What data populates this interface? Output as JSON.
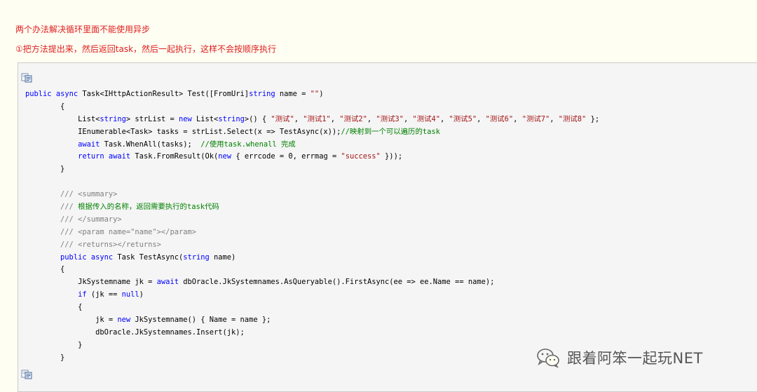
{
  "article": {
    "heading1": "两个办法解决循环里面不能使用异步",
    "heading2": "①把方法提出来，然后返回task，然后一起执行，这样不会按顺序执行"
  },
  "code": {
    "copy_icon": "copy-icon",
    "lines": [
      [
        {
          "t": "public",
          "c": "kw"
        },
        {
          "t": " "
        },
        {
          "t": "async",
          "c": "kw"
        },
        {
          "t": " Task<IHttpActionResult> Test([FromUri]"
        },
        {
          "t": "string",
          "c": "kw"
        },
        {
          "t": " name = "
        },
        {
          "t": "\"\"",
          "c": "str"
        },
        {
          "t": ")"
        }
      ],
      [
        {
          "t": "        {"
        }
      ],
      [
        {
          "t": "            List<"
        },
        {
          "t": "string",
          "c": "kw"
        },
        {
          "t": "> strList = "
        },
        {
          "t": "new",
          "c": "kw"
        },
        {
          "t": " List<"
        },
        {
          "t": "string",
          "c": "kw"
        },
        {
          "t": ">() { "
        },
        {
          "t": "\"测试\"",
          "c": "str"
        },
        {
          "t": ", "
        },
        {
          "t": "\"测试1\"",
          "c": "str"
        },
        {
          "t": ", "
        },
        {
          "t": "\"测试2\"",
          "c": "str"
        },
        {
          "t": ", "
        },
        {
          "t": "\"测试3\"",
          "c": "str"
        },
        {
          "t": ", "
        },
        {
          "t": "\"测试4\"",
          "c": "str"
        },
        {
          "t": ", "
        },
        {
          "t": "\"测试5\"",
          "c": "str"
        },
        {
          "t": ", "
        },
        {
          "t": "\"测试6\"",
          "c": "str"
        },
        {
          "t": ", "
        },
        {
          "t": "\"测试7\"",
          "c": "str"
        },
        {
          "t": ", "
        },
        {
          "t": "\"测试8\"",
          "c": "str"
        },
        {
          "t": " };"
        }
      ],
      [
        {
          "t": "            IEnumerable<Task> tasks = strList.Select(x => TestAsync(x));"
        },
        {
          "t": "//映射到一个可以遍历的task",
          "c": "cm"
        }
      ],
      [
        {
          "t": "            "
        },
        {
          "t": "await",
          "c": "kw"
        },
        {
          "t": " Task.WhenAll(tasks);  "
        },
        {
          "t": "//使用task.whenall 完成",
          "c": "cm"
        }
      ],
      [
        {
          "t": "            "
        },
        {
          "t": "return",
          "c": "kw"
        },
        {
          "t": " "
        },
        {
          "t": "await",
          "c": "kw"
        },
        {
          "t": " Task.FromResult(Ok("
        },
        {
          "t": "new",
          "c": "kw"
        },
        {
          "t": " { errcode = 0, errmag = "
        },
        {
          "t": "\"success\"",
          "c": "str"
        },
        {
          "t": " }));"
        }
      ],
      [
        {
          "t": "        }"
        }
      ],
      [
        {
          "t": ""
        }
      ],
      [
        {
          "t": "        "
        },
        {
          "t": "/// <summary>",
          "c": "xml"
        }
      ],
      [
        {
          "t": "        "
        },
        {
          "t": "///",
          "c": "xml"
        },
        {
          "t": " 根据传入的名称，返回需要执行的task代码",
          "c": "cm"
        }
      ],
      [
        {
          "t": "        "
        },
        {
          "t": "/// </summary>",
          "c": "xml"
        }
      ],
      [
        {
          "t": "        "
        },
        {
          "t": "/// <param name=\"name\"></param>",
          "c": "xml"
        }
      ],
      [
        {
          "t": "        "
        },
        {
          "t": "/// <returns></returns>",
          "c": "xml"
        }
      ],
      [
        {
          "t": "        "
        },
        {
          "t": "public",
          "c": "kw"
        },
        {
          "t": " "
        },
        {
          "t": "async",
          "c": "kw"
        },
        {
          "t": " Task TestAsync("
        },
        {
          "t": "string",
          "c": "kw"
        },
        {
          "t": " name)"
        }
      ],
      [
        {
          "t": "        {"
        }
      ],
      [
        {
          "t": "            JkSystemname jk = "
        },
        {
          "t": "await",
          "c": "kw"
        },
        {
          "t": " dbOracle.JkSystemnames.AsQueryable().FirstAsync(ee => ee.Name == name);"
        }
      ],
      [
        {
          "t": "            "
        },
        {
          "t": "if",
          "c": "kw"
        },
        {
          "t": " (jk == "
        },
        {
          "t": "null",
          "c": "kw"
        },
        {
          "t": ")"
        }
      ],
      [
        {
          "t": "            {"
        }
      ],
      [
        {
          "t": "                jk = "
        },
        {
          "t": "new",
          "c": "kw"
        },
        {
          "t": " JkSystemname() { Name = name };"
        }
      ],
      [
        {
          "t": "                dbOracle.JkSystemnames.Insert(jk);"
        }
      ],
      [
        {
          "t": "            }"
        }
      ],
      [
        {
          "t": "        }"
        }
      ]
    ]
  },
  "watermark": {
    "text": "跟着阿笨一起玩NET",
    "icon": "wechat-icon"
  }
}
